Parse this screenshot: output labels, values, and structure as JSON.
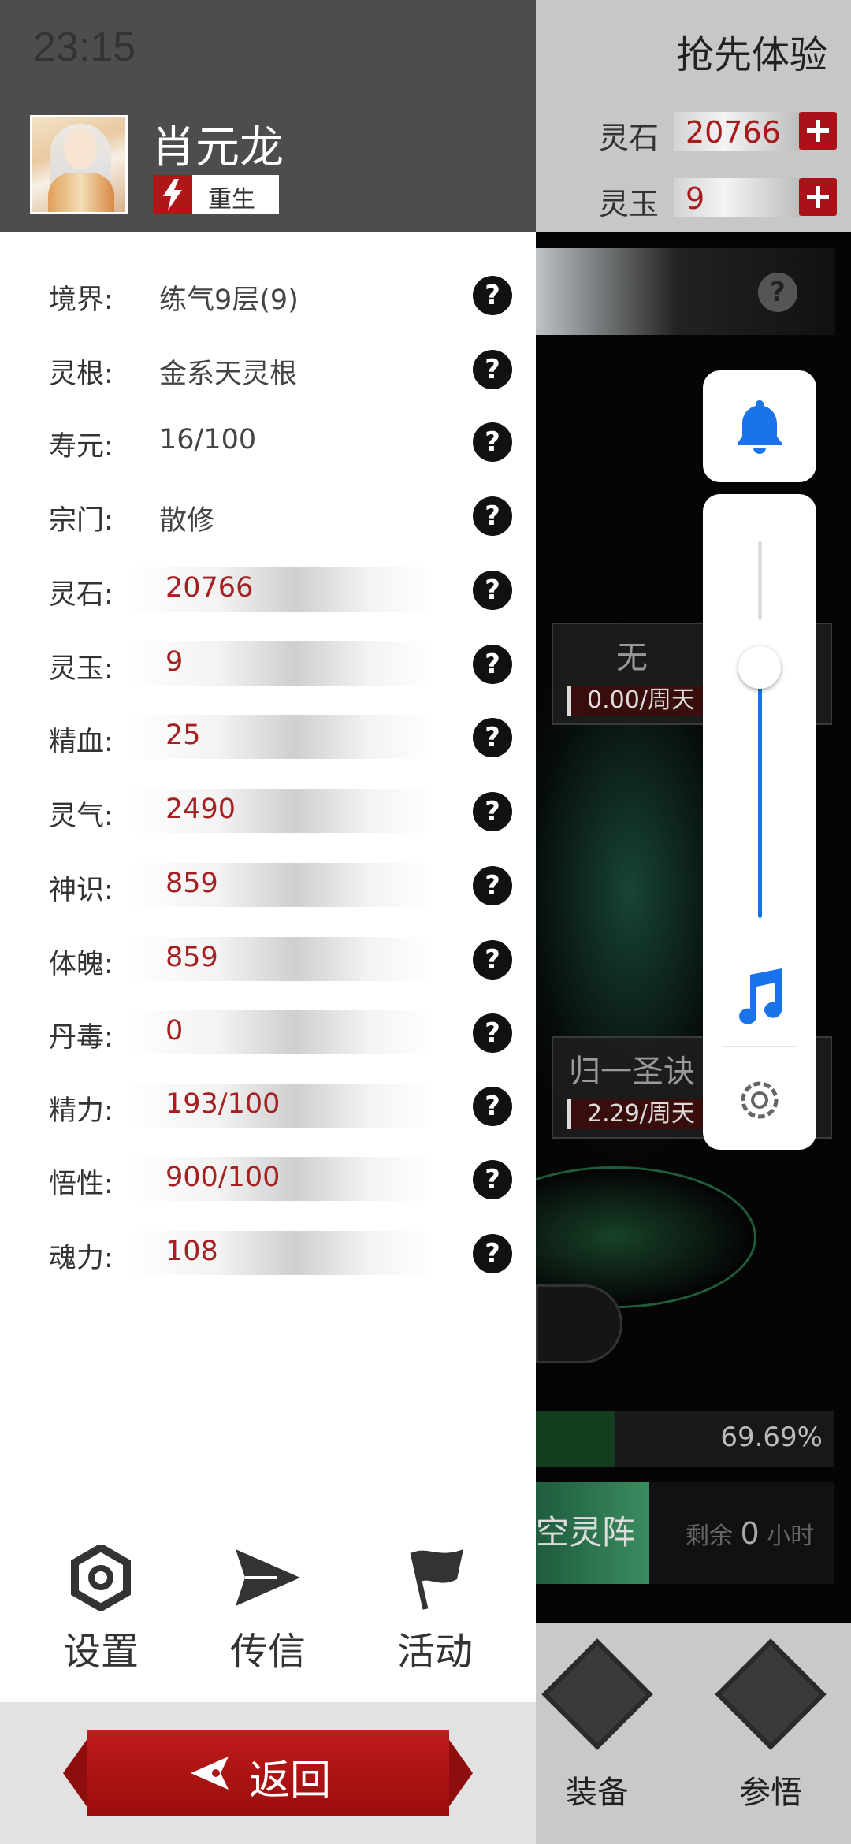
{
  "status_bar": {
    "time": "23:15"
  },
  "background": {
    "header_title": "抢先体验",
    "resources": [
      {
        "label": "灵石",
        "value": "20766"
      },
      {
        "label": "灵玉",
        "value": "9"
      }
    ],
    "cards": [
      {
        "title": "无",
        "rate": "0.00/周天"
      },
      {
        "title": "归一圣诀",
        "rate": "2.29/周天"
      }
    ],
    "progress_percent_label": "69.69%",
    "progress_fraction": 0.6969,
    "cta_label": "空灵阵",
    "remaining_prefix": "剩余",
    "remaining_value": "0",
    "remaining_unit": "小时",
    "bottom_nav": [
      {
        "label": "装备",
        "icon": "sword-diamond-icon"
      },
      {
        "label": "参悟",
        "icon": "book-diamond-icon"
      }
    ]
  },
  "control_center": {
    "volume_level": 0.66,
    "icons": [
      "bell-icon",
      "music-note-icon",
      "gear-icon"
    ],
    "accent_color": "#1a73e8"
  },
  "drawer": {
    "player": {
      "name": "肖元龙",
      "status_badge": "重生"
    },
    "stats_plain": [
      {
        "label": "境界:",
        "value": "练气9层(9)"
      },
      {
        "label": "灵根:",
        "value": "金系天灵根"
      },
      {
        "label": "寿元:",
        "value": "16/100"
      },
      {
        "label": "宗门:",
        "value": "散修"
      }
    ],
    "stats_bar": [
      {
        "label": "灵石:",
        "value": "20766"
      },
      {
        "label": "灵玉:",
        "value": "9"
      },
      {
        "label": "精血:",
        "value": "25"
      },
      {
        "label": "灵气:",
        "value": "2490"
      },
      {
        "label": "神识:",
        "value": "859"
      },
      {
        "label": "体魄:",
        "value": "859"
      },
      {
        "label": "丹毒:",
        "value": "0"
      },
      {
        "label": "精力:",
        "value": "193/100"
      },
      {
        "label": "悟性:",
        "value": "900/100"
      },
      {
        "label": "魂力:",
        "value": "108"
      }
    ],
    "help_glyph": "?",
    "nav": [
      {
        "label": "设置",
        "icon": "settings-ring-icon"
      },
      {
        "label": "传信",
        "icon": "paper-plane-icon"
      },
      {
        "label": "活动",
        "icon": "flag-icon"
      }
    ],
    "back_label": "返回",
    "value_color": "#a52020"
  }
}
